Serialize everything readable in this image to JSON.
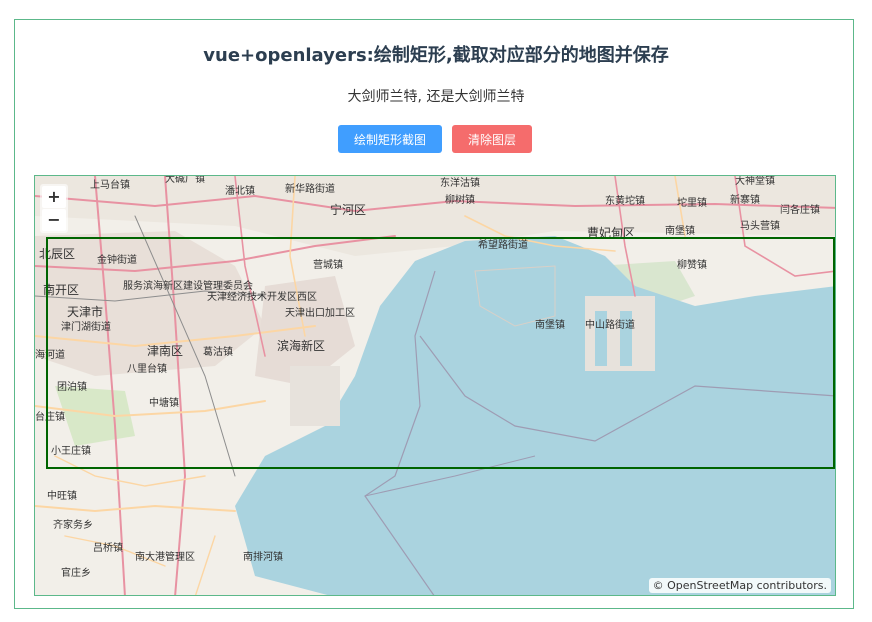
{
  "page": {
    "title": "vue+openlayers:绘制矩形,截取对应部分的地图并保存",
    "subtitle": "大剑师兰特, 还是大剑师兰特"
  },
  "toolbar": {
    "draw_label": "绘制矩形截图",
    "clear_label": "清除图层",
    "draw_color": "#409eff",
    "clear_color": "#f56c6c"
  },
  "map": {
    "zoom_in_label": "+",
    "zoom_out_label": "−",
    "attribution": "© OpenStreetMap contributors.",
    "rectangle_color": "#006400",
    "sea_color": "#aad3df",
    "land_color": "#f2efe9",
    "labels": {
      "shangguzhuang": "上马台镇",
      "dabizhen": "大碱厂镇",
      "hebeizhen": "潘北镇",
      "xinjie": "新华路街道",
      "shizizhen": "东洋沽镇",
      "liushu": "柳树镇",
      "dahezhen": "大神堂镇",
      "ninghe": "宁河区",
      "dongyang": "东黄坨镇",
      "dibei": "坨里镇",
      "xinzhai": "新寨镇",
      "yanzhuang": "闫各庄镇",
      "caofeidian": "曹妃甸区",
      "nanpu": "南堡镇",
      "matou": "马头营镇",
      "beichen": "北辰区",
      "jinzhong": "金钟街道",
      "yingcheng": "营城镇",
      "xiwang": "希望路街道",
      "liuzan": "柳赞镇",
      "nankai": "南开区",
      "binhaixin": "服务滨海新区建设管理委员会",
      "tianjinjingji": "天津经济技术开发区西区",
      "tianjin": "天津市",
      "tianjinchukou": "天津出口加工区",
      "jinmen": "津门湖街道",
      "nanbaozhen": "南堡镇",
      "zhongshan": "中山路街道",
      "jinnan": "津南区",
      "gegu": "葛沽镇",
      "binhai": "滨海新区",
      "haihe": "海河道",
      "balitai": "八里台镇",
      "zhuo": "团泊镇",
      "zhongtang": "中塘镇",
      "tai": "台庄镇",
      "xiaowang": "小王庄镇",
      "zhongwang": "中旺镇",
      "qijia": "齐家务乡",
      "lvqiao": "吕桥镇",
      "nandagang": "南大港管理区",
      "nanpai": "南排河镇",
      "guanzhuang": "官庄乡"
    }
  }
}
